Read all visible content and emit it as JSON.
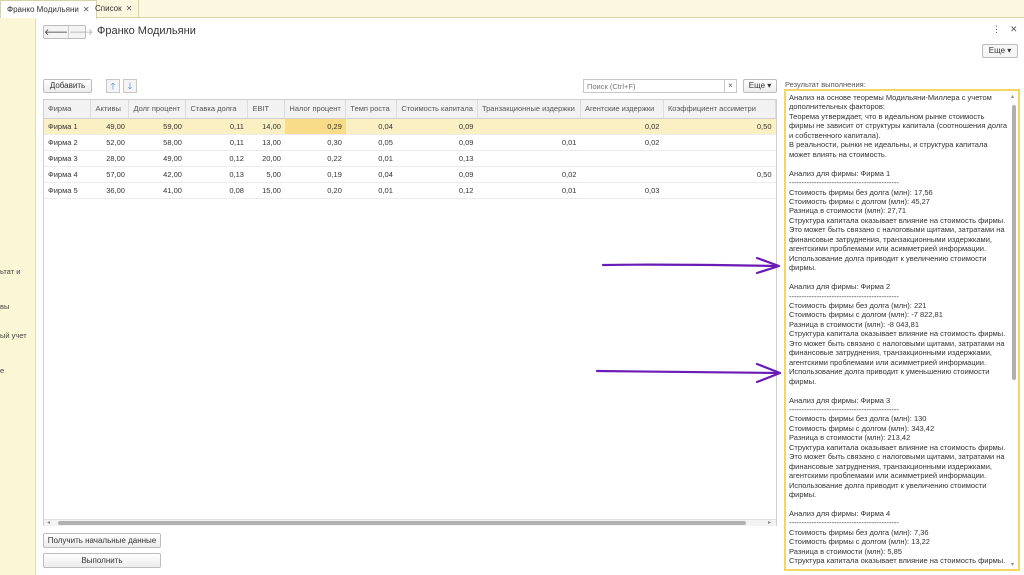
{
  "tabs": [
    {
      "label": "Франко Модильяни",
      "active": true
    },
    {
      "label": "Список",
      "active": false
    }
  ],
  "sidebar_fragments": [
    "ьтат и",
    "вы",
    "ый учет",
    "е"
  ],
  "header": {
    "title": "Франко Модильяни",
    "more_label": "Еще"
  },
  "toolbar": {
    "add_label": "Добавить",
    "search_placeholder": "Поиск (Ctrl+F)",
    "clear_label": "×",
    "more_label": "Еще"
  },
  "table": {
    "columns": [
      "Фирма",
      "Активы",
      "Долг процент",
      "Ставка долга",
      "EBIT",
      "Налог процент",
      "Темп роста",
      "Стоимость капитала",
      "Транзакционные издержки",
      "Агентские издержки",
      "Коэффициент ассиметри"
    ],
    "rows": [
      [
        "Фирма 1",
        "49,00",
        "59,00",
        "0,11",
        "14,00",
        "0,29",
        "0,04",
        "0,09",
        "",
        "0,02",
        "0,50"
      ],
      [
        "Фирма 2",
        "52,00",
        "58,00",
        "0,11",
        "13,00",
        "0,30",
        "0,05",
        "0,09",
        "0,01",
        "0,02",
        ""
      ],
      [
        "Фирма 3",
        "28,00",
        "49,00",
        "0,12",
        "20,00",
        "0,22",
        "0,01",
        "0,13",
        "",
        "",
        ""
      ],
      [
        "Фирма 4",
        "57,00",
        "42,00",
        "0,13",
        "5,00",
        "0,19",
        "0,04",
        "0,09",
        "0,02",
        "",
        "0,50"
      ],
      [
        "Фирма 5",
        "36,00",
        "41,00",
        "0,08",
        "15,00",
        "0,20",
        "0,01",
        "0,12",
        "0,01",
        "0,03",
        ""
      ]
    ]
  },
  "buttons": {
    "get_data": "Получить начальные данные",
    "run": "Выполнить"
  },
  "result": {
    "label": "Результат выполнения:",
    "lines": [
      "Анализ на основе теоремы Модильяни-Миллера с учетом",
      "дополнительных факторов:",
      "Теорема утверждает, что в идеальном рынке стоимость",
      "фирмы не зависит от структуры капитала (соотношения долга",
      "и собственного капитала).",
      "В реальности, рынки не идеальны, и структура капитала",
      "может влиять на стоимость.",
      "",
      "Анализ для фирмы: Фирма 1",
      "--------------------------------------------",
      "Стоимость фирмы без долга (млн): 17,56",
      "Стоимость фирмы с долгом (млн): 45,27",
      "Разница в стоимости (млн): 27,71",
      "Структура капитала оказывает влияние на стоимость фирмы.",
      "Это может быть связано с налоговыми щитами, затратами на",
      "финансовые затруднения, транзакционными издержками,",
      "агентскими проблемами или асимметрией информации.",
      "Использование долга приводит к увеличению стоимости",
      "фирмы.",
      "",
      "Анализ для фирмы: Фирма 2",
      "--------------------------------------------",
      "Стоимость фирмы без долга (млн): 221",
      "Стоимость фирмы с долгом (млн): -7 822,81",
      "Разница в стоимости (млн): -8 043,81",
      "Структура капитала оказывает влияние на стоимость фирмы.",
      "Это может быть связано с налоговыми щитами, затратами на",
      "финансовые затруднения, транзакционными издержками,",
      "агентскими проблемами или асимметрией информации.",
      "Использование долга приводит к уменьшению стоимости",
      "фирмы.",
      "",
      "Анализ для фирмы: Фирма 3",
      "--------------------------------------------",
      "Стоимость фирмы без долга (млн): 130",
      "Стоимость фирмы с долгом (млн): 343,42",
      "Разница в стоимости (млн): 213,42",
      "Структура капитала оказывает влияние на стоимость фирмы.",
      "Это может быть связано с налоговыми щитами, затратами на",
      "финансовые затруднения, транзакционными издержками,",
      "агентскими проблемами или асимметрией информации.",
      "Использование долга приводит к увеличению стоимости",
      "фирмы.",
      "",
      "Анализ для фирмы: Фирма 4",
      "--------------------------------------------",
      "Стоимость фирмы без долга (млн): 7,36",
      "Стоимость фирмы с долгом (млн): 13,22",
      "Разница в стоимости (млн): 5,85",
      "Структура капитала оказывает влияние на стоимость фирмы."
    ]
  },
  "colors": {
    "accent_yellow": "#f5d660",
    "selected_row": "#fbf0c3",
    "annotation_purple": "#6a1bb5"
  }
}
